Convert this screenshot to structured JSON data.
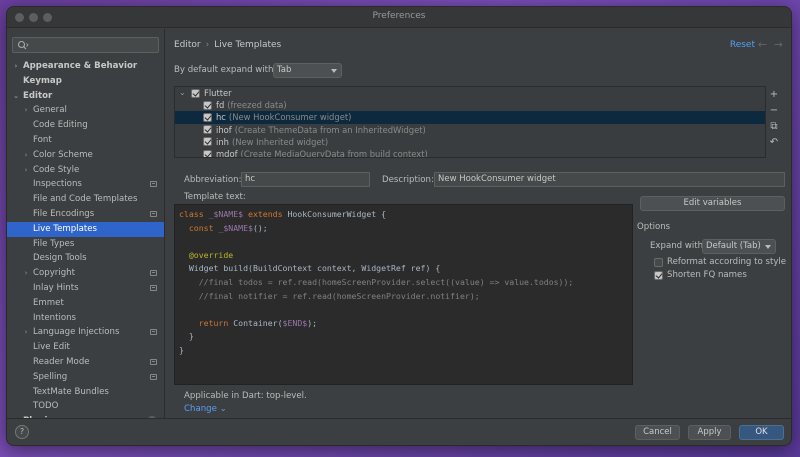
{
  "window": {
    "title": "Preferences"
  },
  "search": {
    "placeholder": ""
  },
  "sidebar": {
    "items": [
      {
        "label": "Appearance & Behavior",
        "arrow": "›",
        "bold": true,
        "indent": 0
      },
      {
        "label": "Keymap",
        "arrow": "",
        "bold": true,
        "indent": 0
      },
      {
        "label": "Editor",
        "arrow": "⌄",
        "bold": true,
        "indent": 0
      },
      {
        "label": "General",
        "arrow": "›",
        "indent": 1
      },
      {
        "label": "Code Editing",
        "arrow": "",
        "indent": 1
      },
      {
        "label": "Font",
        "arrow": "",
        "indent": 1
      },
      {
        "label": "Color Scheme",
        "arrow": "›",
        "indent": 1
      },
      {
        "label": "Code Style",
        "arrow": "›",
        "indent": 1
      },
      {
        "label": "Inspections",
        "arrow": "",
        "indent": 1,
        "badge": true
      },
      {
        "label": "File and Code Templates",
        "arrow": "",
        "indent": 1
      },
      {
        "label": "File Encodings",
        "arrow": "",
        "indent": 1,
        "badge": true
      },
      {
        "label": "Live Templates",
        "arrow": "",
        "indent": 1,
        "selected": true
      },
      {
        "label": "File Types",
        "arrow": "",
        "indent": 1
      },
      {
        "label": "Design Tools",
        "arrow": "",
        "indent": 1
      },
      {
        "label": "Copyright",
        "arrow": "›",
        "indent": 1,
        "badge": true
      },
      {
        "label": "Inlay Hints",
        "arrow": "",
        "indent": 1,
        "badge": true
      },
      {
        "label": "Emmet",
        "arrow": "",
        "indent": 1
      },
      {
        "label": "Intentions",
        "arrow": "",
        "indent": 1
      },
      {
        "label": "Language Injections",
        "arrow": "›",
        "indent": 1,
        "badge": true
      },
      {
        "label": "Live Edit",
        "arrow": "",
        "indent": 1
      },
      {
        "label": "Reader Mode",
        "arrow": "",
        "indent": 1,
        "badge": true
      },
      {
        "label": "Spelling",
        "arrow": "",
        "indent": 1,
        "badge": true
      },
      {
        "label": "TextMate Bundles",
        "arrow": "",
        "indent": 1
      },
      {
        "label": "TODO",
        "arrow": "",
        "indent": 1
      },
      {
        "label": "Plugins",
        "arrow": "",
        "bold": true,
        "indent": 0,
        "count": "1"
      }
    ]
  },
  "help": {
    "label": "?"
  },
  "header": {
    "crumb1": "Editor",
    "crumb_sep": "›",
    "crumb2": "Live Templates",
    "reset": "Reset",
    "back": "←",
    "forward": "→"
  },
  "expand": {
    "label": "By default expand with",
    "value": "Tab"
  },
  "templates": {
    "group": {
      "label": "Flutter",
      "arrow": "⌄"
    },
    "rows": [
      {
        "abbr": "fd",
        "desc": "(freezed data)"
      },
      {
        "abbr": "hc",
        "desc": "(New HookConsumer widget)",
        "selected": true
      },
      {
        "abbr": "ihof",
        "desc": "(Create ThemeData from an InheritedWidget)"
      },
      {
        "abbr": "inh",
        "desc": "(New Inherited widget)"
      },
      {
        "abbr": "mdof",
        "desc": "(Create MediaQueryData from build context)"
      }
    ]
  },
  "tools": {
    "add": "+",
    "remove": "−",
    "copy": "⧉",
    "restore": "↶"
  },
  "abbreviation": {
    "label": "Abbreviation:",
    "value": "hc"
  },
  "description": {
    "label": "Description:",
    "value": "New HookConsumer widget"
  },
  "template_text": {
    "label": "Template text:"
  },
  "edit_variables": "Edit variables",
  "options": {
    "title": "Options",
    "expand_with_label": "Expand with",
    "expand_with_value": "Default (Tab)",
    "reformat_label": "Reformat according to style",
    "reformat_checked": false,
    "shorten_label": "Shorten FQ names",
    "shorten_checked": true
  },
  "applicable": "Applicable in Dart: top-level.",
  "change": "Change ⌄",
  "footer": {
    "cancel": "Cancel",
    "apply": "Apply",
    "ok": "OK"
  },
  "colors": {
    "accent": "#589df6",
    "selected_bg": "#2f65ca",
    "primary_button": "#365880"
  }
}
